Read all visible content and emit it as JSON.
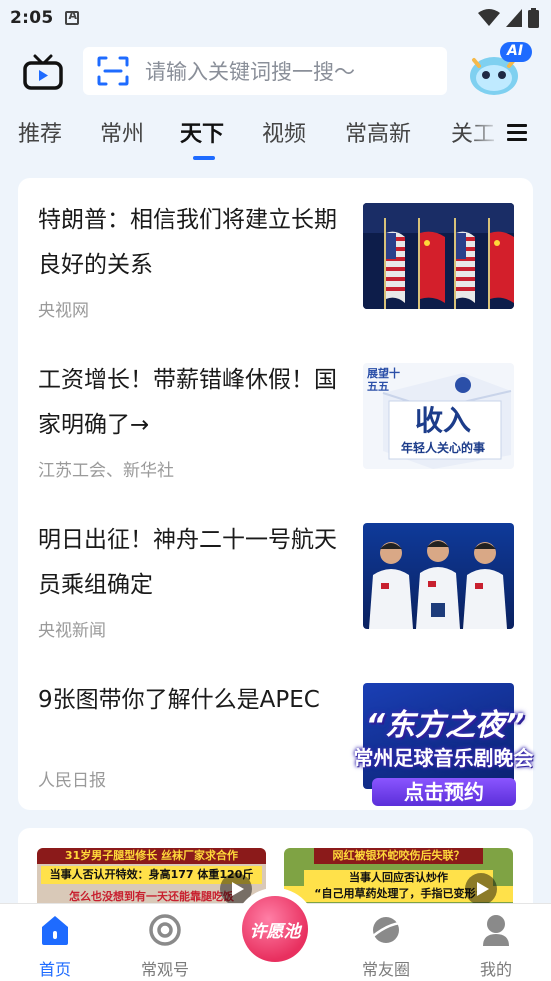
{
  "status_bar": {
    "time": "2:05"
  },
  "search": {
    "placeholder": "请输入关键词搜一搜～"
  },
  "ai_badge": "AI",
  "tabs": [
    {
      "label": "推荐"
    },
    {
      "label": "常州"
    },
    {
      "label": "天下",
      "active": true
    },
    {
      "label": "视频"
    },
    {
      "label": "常高新"
    },
    {
      "label": "关工"
    }
  ],
  "news": [
    {
      "title": "特朗普：相信我们将建立长期良好的关系",
      "source": "央视网"
    },
    {
      "title": "工资增长！带薪错峰休假！国家明确了→",
      "source": "江苏工会、新华社",
      "thumb_text": "收入",
      "thumb_sub": "年轻人关心的事",
      "thumb_corner": "展望十五五"
    },
    {
      "title": "明日出征！神舟二十一号航天员乘组确定",
      "source": "央视新闻"
    },
    {
      "title": "9张图带你了解什么是APEC",
      "source": "人民日报"
    }
  ],
  "video_cards": [
    {
      "caption_top": "31岁男子腿型修长 丝袜厂家求合作",
      "caption_mid": "当事人否认开特效：身高177 体重120斤",
      "caption_bottom": "怎么也没想到有一天还能靠腿吃饭"
    },
    {
      "caption_top": "网红被银环蛇咬伤后失联？",
      "caption_mid": "当事人回应否认炒作",
      "caption_bottom": "“自己用草药处理了，手指已变形”"
    }
  ],
  "promo_banner": {
    "title": "“东方之夜”",
    "subtitle": "常州足球音乐剧晚会",
    "button": "点击预约"
  },
  "wish_button": {
    "label": "许愿池"
  },
  "bottom_nav": [
    {
      "label": "首页",
      "active": true
    },
    {
      "label": "常观号"
    },
    {
      "label": "常友圈"
    },
    {
      "label": "我的"
    }
  ],
  "colors": {
    "accent": "#1e6bff",
    "background": "#eef4fb",
    "wish": "#e8305f"
  }
}
